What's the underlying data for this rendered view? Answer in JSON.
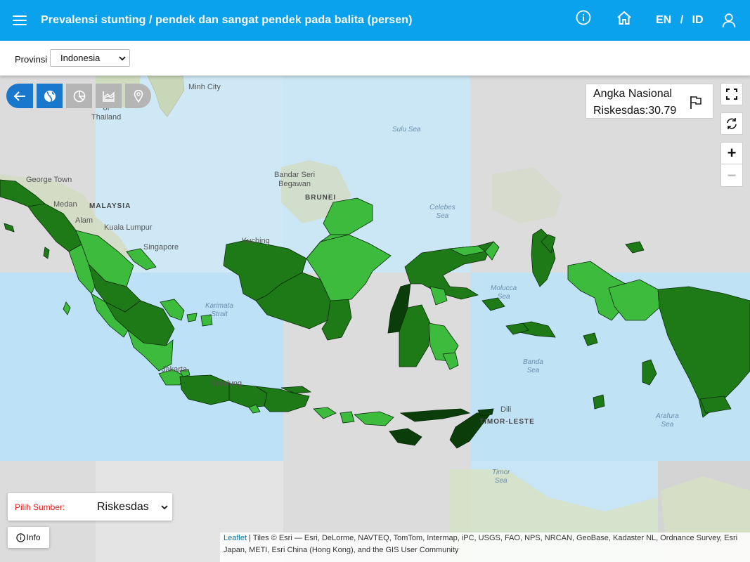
{
  "appbar": {
    "title": "Prevalensi stunting / pendek dan sangat pendek pada balita (persen)",
    "lang_en": "EN",
    "lang_sep": "/",
    "lang_id": "ID",
    "icons": [
      "menu-icon",
      "info-icon",
      "home-icon",
      "user-icon"
    ],
    "bg_color": "#0aa2ec"
  },
  "toolbar": {
    "provinsi_label": "Provinsi",
    "provinsi_value": "Indonesia"
  },
  "map_controls": {
    "buttons": [
      "back-arrow-icon",
      "globe-icon",
      "pie-chart-icon",
      "area-chart-icon",
      "map-pin-icon"
    ],
    "active_color": "#1977cc",
    "inactive_color": "#b5b5b5"
  },
  "national": {
    "line1": "Angka Nasional",
    "line2": "Riskesdas:30.79"
  },
  "zoom": {
    "in": "+",
    "out": "−"
  },
  "source": {
    "label": "Pilih Sumber:",
    "value": "Riskesdas"
  },
  "info_button": "Info",
  "attribution": {
    "leaflet": "Leaflet",
    "text": " | Tiles © Esri — Esri, DeLorme, NAVTEQ, TomTom, Intermap, iPC, USGS, FAO, NPS, NRCAN, GeoBase, Kadaster NL, Ordnance Survey, Esri Japan, METI, Esri China (Hong Kong), and the GIS User Community"
  },
  "place_labels": {
    "minh_city": "Minh City",
    "gulf_thailand": "of\nThailand",
    "sulu_sea": "Sulu Sea",
    "george_town": "George Town",
    "bandar_seri": "Bandar Seri\nBegawan",
    "brunei": "BRUNEI",
    "medan": "Medan",
    "malaysia": "MALAYSIA",
    "alam": "Alam",
    "kuala_lumpur": "Kuala Lumpur",
    "celebes_sea": "Celebes\nSea",
    "singapore": "Singapore",
    "kuching": "Kuching",
    "molucca_sea": "Molucca\nSea",
    "karimata": "Karimata\nStrait",
    "banda_sea": "Banda\nSea",
    "jakarta": "Jakarta",
    "bandung": "Bandung",
    "dili": "Dili",
    "timor_leste": "TIMOR-LESTE",
    "arafura_sea": "Arafura\nSea",
    "timor_sea": "Timor\nSea"
  },
  "legend_colors": {
    "very_dark": "#0b3d0b",
    "dark": "#1e7a16",
    "medium": "#2e9e2a",
    "light": "#3dbb3d"
  }
}
